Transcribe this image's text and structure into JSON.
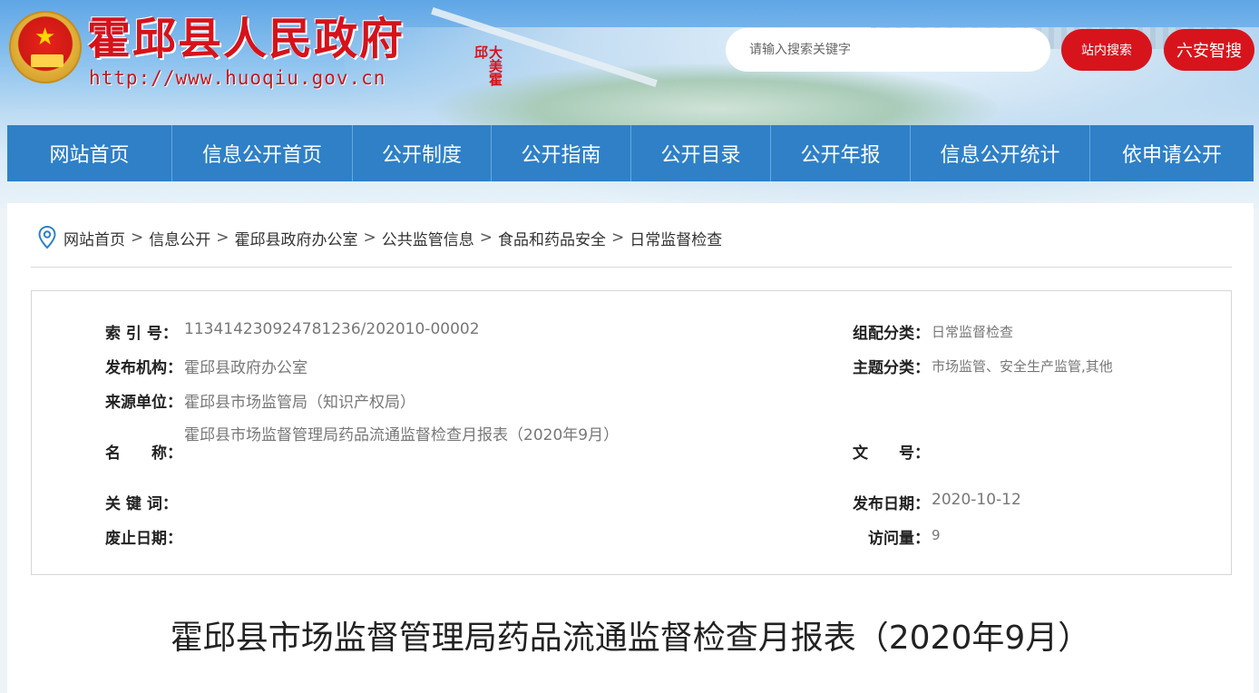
{
  "header": {
    "site_title": "霍邱县人民政府",
    "site_url": "http://www.huoqiu.gov.cn",
    "seal_text": "大美霍邱",
    "search_placeholder": "请输入搜索关键字",
    "search_button": "站内搜索",
    "liuan_button": "六安智搜"
  },
  "nav": {
    "items": [
      "网站首页",
      "信息公开首页",
      "公开制度",
      "公开指南",
      "公开目录",
      "公开年报",
      "信息公开统计",
      "依申请公开"
    ]
  },
  "breadcrumb": {
    "items": [
      "网站首页",
      "信息公开",
      "霍邱县政府办公室",
      "公共监管信息",
      "食品和药品安全",
      "日常监督检查"
    ],
    "separator": ">"
  },
  "meta": {
    "index_label": "索 引 号：",
    "index_value": "113414230924781236/202010-00002",
    "org_label": "发布机构：",
    "org_value": "霍邱县政府办公室",
    "source_label": "来源单位：",
    "source_value": "霍邱县市场监管局（知识产权局）",
    "name_label": "名　　称：",
    "name_value": "霍邱县市场监督管理局药品流通监督检查月报表（2020年9月）",
    "keywords_label": "关 键 词：",
    "keywords_value": "",
    "expiry_label": "废止日期：",
    "expiry_value": "",
    "group_label": "组配分类：",
    "group_value": "日常监督检查",
    "topic_label": "主题分类：",
    "topic_value": "市场监管、安全生产监管,其他",
    "docno_label": "文　　号：",
    "docno_value": "",
    "date_label": "发布日期：",
    "date_value": "2020-10-12",
    "views_label": "访问量：",
    "views_value": "9"
  },
  "article": {
    "title": "霍邱县市场监督管理局药品流通监督检查月报表（2020年9月）"
  },
  "colors": {
    "brand_red": "#d7141c",
    "nav_blue": "#2f80c7",
    "pin_blue": "#2f80c7"
  }
}
